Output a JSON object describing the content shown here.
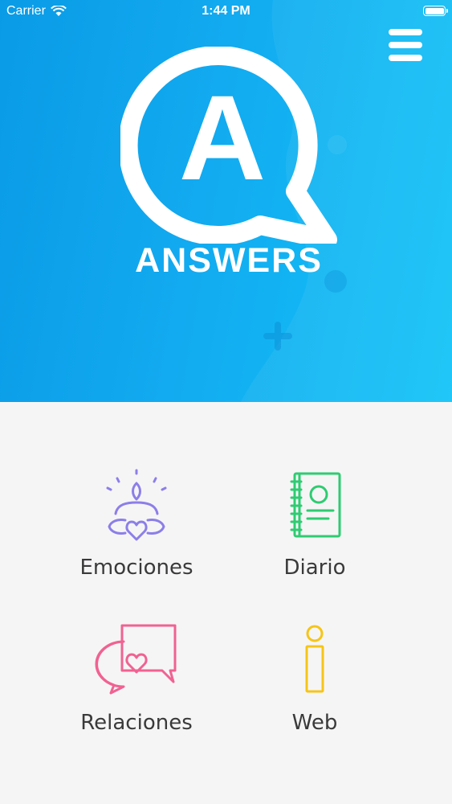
{
  "status_bar": {
    "carrier": "Carrier",
    "time": "1:44 PM"
  },
  "header": {
    "logo_letter": "A",
    "logo_text": "ANSWERS",
    "menu_icon": "hamburger-menu-icon"
  },
  "menu": {
    "items": [
      {
        "label": "Emociones",
        "icon": "emotions-icon",
        "color": "#8b7fe8"
      },
      {
        "label": "Diario",
        "icon": "diary-icon",
        "color": "#2ecc71"
      },
      {
        "label": "Relaciones",
        "icon": "relationships-icon",
        "color": "#f06292"
      },
      {
        "label": "Web",
        "icon": "info-icon",
        "color": "#f5c518"
      }
    ]
  },
  "colors": {
    "hero_start": "#0a9be6",
    "hero_end": "#13c4f7",
    "background": "#f6f5f6"
  }
}
